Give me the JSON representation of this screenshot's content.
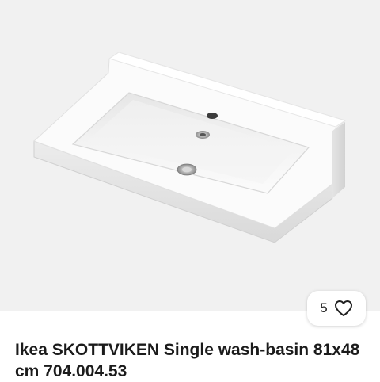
{
  "listing": {
    "image_alt": "Ikea SKOTTVIKEN Single wash-basin",
    "favorite_count": "5",
    "title": "Ikea SKOTTVIKEN Single wash-basin 81x48 cm 704.004.53"
  },
  "icons": {
    "favorite": "heart-outline-icon"
  },
  "colors": {
    "photo_background": "#f1f1f1",
    "title_text": "#1b1b1b"
  }
}
